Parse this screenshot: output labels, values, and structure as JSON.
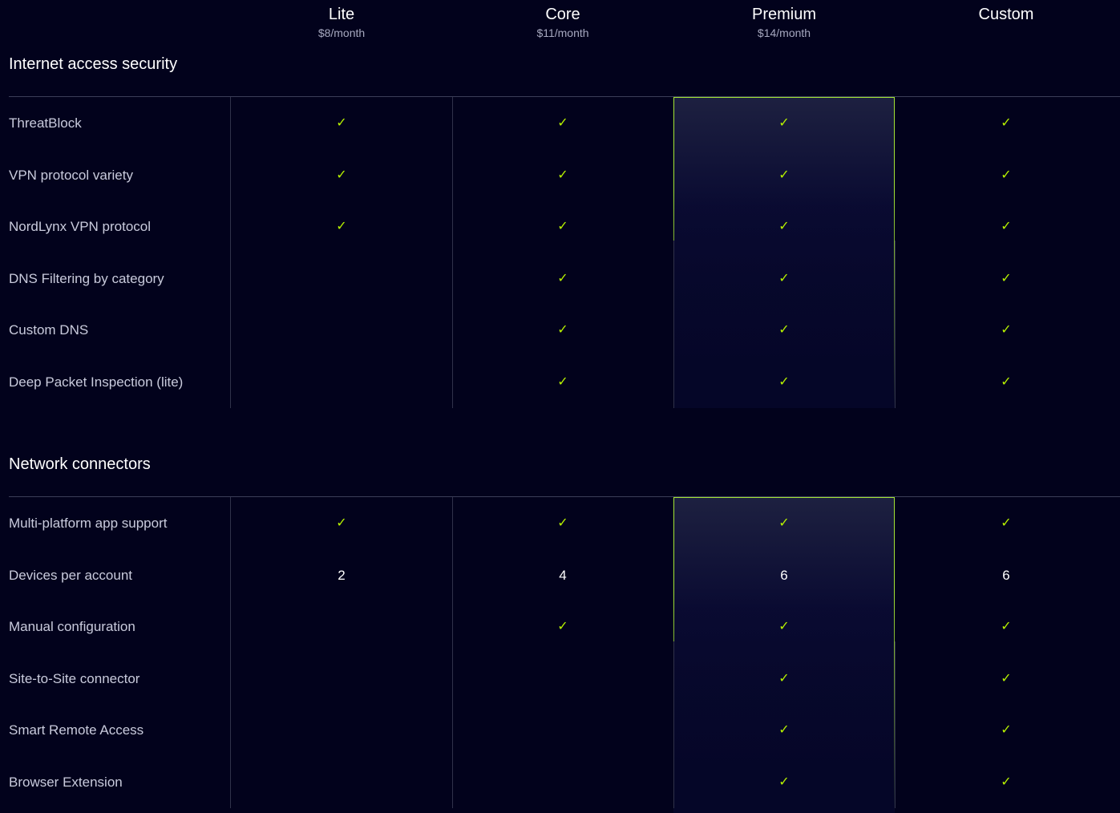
{
  "plans": [
    {
      "name": "Lite",
      "price": "$8/month"
    },
    {
      "name": "Core",
      "price": "$11/month"
    },
    {
      "name": "Premium",
      "price": "$14/month"
    },
    {
      "name": "Custom",
      "price": ""
    }
  ],
  "check_symbol": "✓",
  "accent_color": "#a3e635",
  "background_color": "#02021c",
  "sections": [
    {
      "title": "Internet access security",
      "rows": [
        {
          "label": "ThreatBlock",
          "values": [
            "✓",
            "✓",
            "✓",
            "✓"
          ]
        },
        {
          "label": "VPN protocol variety",
          "values": [
            "✓",
            "✓",
            "✓",
            "✓"
          ]
        },
        {
          "label": "NordLynx VPN protocol",
          "values": [
            "✓",
            "✓",
            "✓",
            "✓"
          ]
        },
        {
          "label": "DNS Filtering by category",
          "values": [
            "",
            "✓",
            "✓",
            "✓"
          ]
        },
        {
          "label": "Custom DNS",
          "values": [
            "",
            "✓",
            "✓",
            "✓"
          ]
        },
        {
          "label": "Deep Packet Inspection (lite)",
          "values": [
            "",
            "✓",
            "✓",
            "✓"
          ]
        }
      ]
    },
    {
      "title": "Network connectors",
      "rows": [
        {
          "label": "Multi-platform app support",
          "values": [
            "✓",
            "✓",
            "✓",
            "✓"
          ]
        },
        {
          "label": "Devices per account",
          "values": [
            "2",
            "4",
            "6",
            "6"
          ]
        },
        {
          "label": "Manual configuration",
          "values": [
            "",
            "✓",
            "✓",
            "✓"
          ]
        },
        {
          "label": "Site-to-Site connector",
          "values": [
            "",
            "",
            "✓",
            "✓"
          ]
        },
        {
          "label": "Smart Remote Access",
          "values": [
            "",
            "",
            "✓",
            "✓"
          ]
        },
        {
          "label": "Browser Extension",
          "values": [
            "",
            "",
            "✓",
            "✓"
          ]
        }
      ]
    }
  ]
}
